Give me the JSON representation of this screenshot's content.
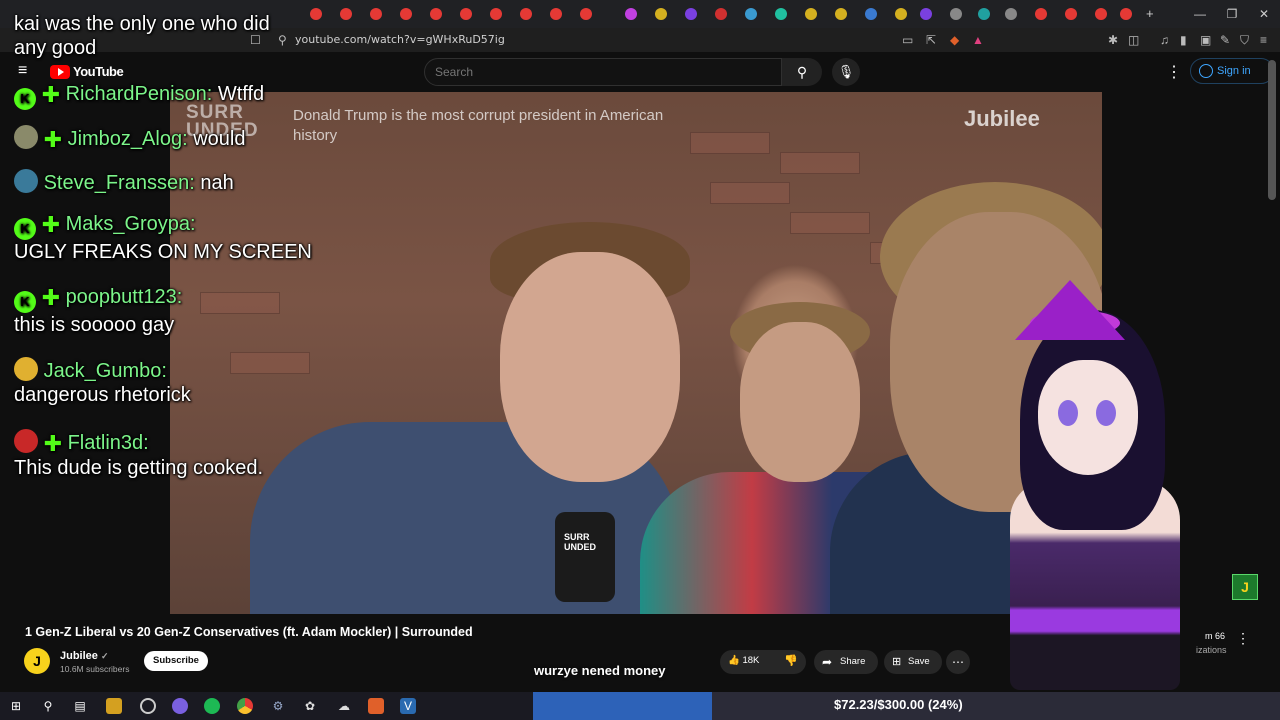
{
  "browser": {
    "url": "youtube.com/watch?v=gWHxRuD57ig"
  },
  "youtube": {
    "logo_text": "YouTube",
    "search_placeholder": "Search",
    "signin_label": "Sign in"
  },
  "video": {
    "overlay_logo": "SURR\nUNDED",
    "overlay_caption": "Donald Trump is the most corrupt president in American history",
    "watermark": "Jubilee",
    "mic_label": "SURR\nUNDED"
  },
  "chat": [
    {
      "user": "kai was the only one who did",
      "text": "any good",
      "badge": "none"
    },
    {
      "user": "RichardPenison:",
      "text": "Wtffd",
      "badge": "kick"
    },
    {
      "user": "Jimboz_Alog:",
      "text": "would",
      "badge": "avatar"
    },
    {
      "user": "Steve_Franssen:",
      "text": "nah",
      "badge": "avatar"
    },
    {
      "user": "Maks_Groypa:",
      "text": "UGLY FREAKS ON MY SCREEN",
      "badge": "kick"
    },
    {
      "user": "poopbutt123:",
      "text": "this is sooooo gay",
      "badge": "kick"
    },
    {
      "user": "Jack_Gumbo:",
      "text": "dangerous rhetorick",
      "badge": "avatar"
    },
    {
      "user": "Flatlin3d:",
      "text": "This dude is getting cooked.",
      "badge": "avatar"
    }
  ],
  "watch": {
    "title": "1 Gen-Z Liberal vs 20 Gen-Z Conservatives (ft. Adam Mockler) | Surrounded",
    "channel_name": "Jubilee",
    "channel_avatar": "J",
    "subscribers": "10.6M subscribers",
    "subscribe_label": "Subscribe",
    "like_count": "18K",
    "share_label": "Share",
    "save_label": "Save",
    "side_views": "m 66",
    "side_sub": "izations"
  },
  "stream": {
    "caption": "wurzye nened money",
    "goal_text": "$72.23/$300.00 (24%)",
    "goal_fraction": 0.24
  },
  "colors": {
    "accent": "#3ea6ff",
    "chat_user": "#7cf58a",
    "kick_green": "#53fc18",
    "progress": "#2d62b8"
  }
}
